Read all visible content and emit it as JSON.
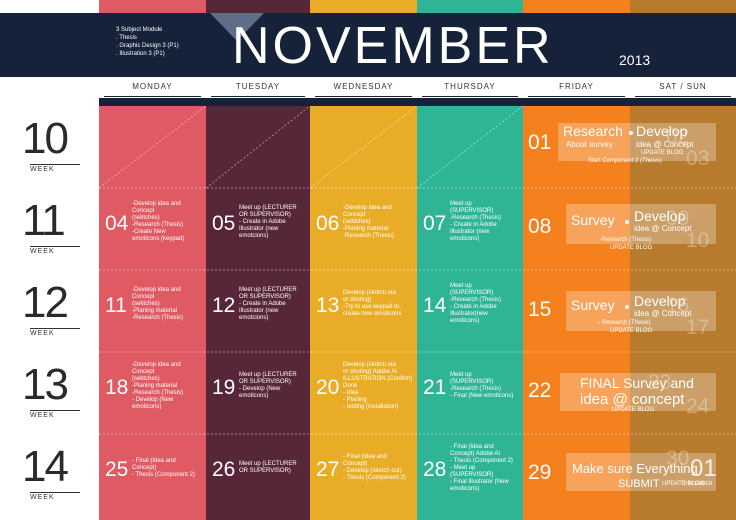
{
  "colors": {
    "monday": "#e05a63",
    "tuesday": "#572639",
    "wednesday": "#e9ac27",
    "thursday": "#2fb596",
    "friday": "#f5801e",
    "weekend": "#b87a2d",
    "header": "#16223a"
  },
  "header": {
    "month": "NOVEMBER",
    "year": "2013",
    "module_title": "3 Subject Module",
    "subjects": [
      ". Thesis",
      ". Graphic Design 3 (P1)",
      ". Illustration 3 (P1)"
    ]
  },
  "days": [
    "MONDAY",
    "TUESDAY",
    "WEDNESDAY",
    "THURSDAY",
    "FRIDAY",
    "SAT / SUN"
  ],
  "weeks": [
    {
      "number": "10",
      "label": "WEEK"
    },
    {
      "number": "11",
      "label": "WEEK"
    },
    {
      "number": "12",
      "label": "WEEK"
    },
    {
      "number": "13",
      "label": "WEEK"
    },
    {
      "number": "14",
      "label": "WEEK"
    }
  ],
  "cells": {
    "w11_mon": {
      "date": "04",
      "lines": [
        "-Develop idea and",
        "Concept",
        "(sektches)",
        "-Research (Thesis)",
        "-Create New",
        "emoticons (keypad)"
      ]
    },
    "w11_tue": {
      "date": "05",
      "lines": [
        "Meet up (LECTURER",
        "OR SUPERVISOR)",
        "- Create in Adobe",
        "Illustrator (new",
        "emotcions)"
      ]
    },
    "w11_wed": {
      "date": "06",
      "lines": [
        "-Develop idea and",
        "Concept",
        "(sektches)",
        "-Planing material",
        "-Research (Thesis)"
      ]
    },
    "w11_thu": {
      "date": "07",
      "lines": [
        "Meet up",
        "(SUPERVISOR)",
        "-Research (Thesis)",
        "- Create in Adobe",
        "Illustrator (new",
        "emoticons)"
      ]
    },
    "w12_mon": {
      "date": "11",
      "lines": [
        "-Develop idea and",
        "Concept",
        "(sektches)",
        "-Planing material",
        "-Research (Thesis)"
      ]
    },
    "w12_tue": {
      "date": "12",
      "lines": [
        "Meet up (LECTURER",
        "OR SUPERVISOR)",
        "- Create in Adobe",
        "Illustrator (new",
        "emotcions)"
      ]
    },
    "w12_wed": {
      "date": "13",
      "lines": [
        "Develop (sketch out",
        "or shoting)",
        "-Try to use keypad to",
        "create new emoticons"
      ]
    },
    "w12_thu": {
      "date": "14",
      "lines": [
        "Meet up",
        "(SUPERVISOR)",
        "-Research (Thesis)",
        "- Create in Adobe",
        "Illustrator(new",
        "emoticons)"
      ]
    },
    "w13_mon": {
      "date": "18",
      "lines": [
        "-Develop idea and",
        "Concept",
        "(sektches)",
        "-Planing material",
        "-Research (Thesis)",
        "- Develop (New",
        "emoticons)"
      ]
    },
    "w13_tue": {
      "date": "19",
      "lines": [
        "Meet up (LECTURER",
        "OR SUPERVISOR)",
        "- Develop (New",
        "emoticons)"
      ]
    },
    "w13_wed": {
      "date": "20",
      "lines": [
        "Develop (sketch out",
        "or shoting) Adobe AI",
        "ILLUSTRATION (Confirm)",
        "Done",
        "- Idea",
        "- Planing",
        "- testing (installation)"
      ]
    },
    "w13_thu": {
      "date": "21",
      "lines": [
        "Meet up",
        "(SUPERVISOR)",
        "-Research (Thesis)",
        "- Final (New emoticons)"
      ]
    },
    "w14_mon": {
      "date": "25",
      "lines": [
        "- Final (Idea and",
        "Concept)",
        "- Thesis (Component 2)"
      ]
    },
    "w14_tue": {
      "date": "26",
      "lines": [
        "Meet up (LECTURER",
        "OR SUPERVISOR)"
      ]
    },
    "w14_wed": {
      "date": "27",
      "lines": [
        "- Final (Idea and",
        "Concept)",
        "- Develop (sketch out)",
        "- Thesis (Component 2)"
      ]
    },
    "w14_thu": {
      "date": "28",
      "lines": [
        "- Final (Idea and",
        "Concept) Adobe AI",
        "- Thesis (Component 2)",
        "- Meet up",
        "(SUPERVISOR)",
        "- Final Illustrator (New",
        "emoticons)"
      ]
    }
  },
  "friday": {
    "w10": {
      "date": "01",
      "left_title": "Research",
      "left_sub": "About survey",
      "right_title": "Develop",
      "right_sub": "idea @ Concept",
      "note1": "UPDATE BLOG",
      "note2": "Start Component 2 (Thesis)",
      "ghost1": "02",
      "ghost2": "03"
    },
    "w11": {
      "date": "08",
      "left_title": "Survey",
      "right_title": "Develop",
      "right_sub": "idea @ Concept",
      "note1": "-Research (Thesis)",
      "note2": "UPDATE BLOG",
      "ghost1": "09",
      "ghost2": "10"
    },
    "w12": {
      "date": "15",
      "left_title": "Survey",
      "right_title": "Develop",
      "right_sub": "idea @ Concept",
      "note1": "- Research (Thesis)",
      "note2": "UPDATE BLOG",
      "ghost1": "16",
      "ghost2": "17"
    },
    "w13": {
      "date": "22",
      "line1": "FINAL Survey and",
      "line2": "idea @ concept",
      "note1": "UPDATE BLOG",
      "ghost1": "23",
      "ghost2": "24"
    },
    "w14": {
      "date": "29",
      "line1": "Make sure Everything",
      "line2": "SUBMIT",
      "note1": "UPDATE BLOG",
      "ghost1": "30",
      "ghost2": "01",
      "next_month": "DECEMBER"
    }
  }
}
